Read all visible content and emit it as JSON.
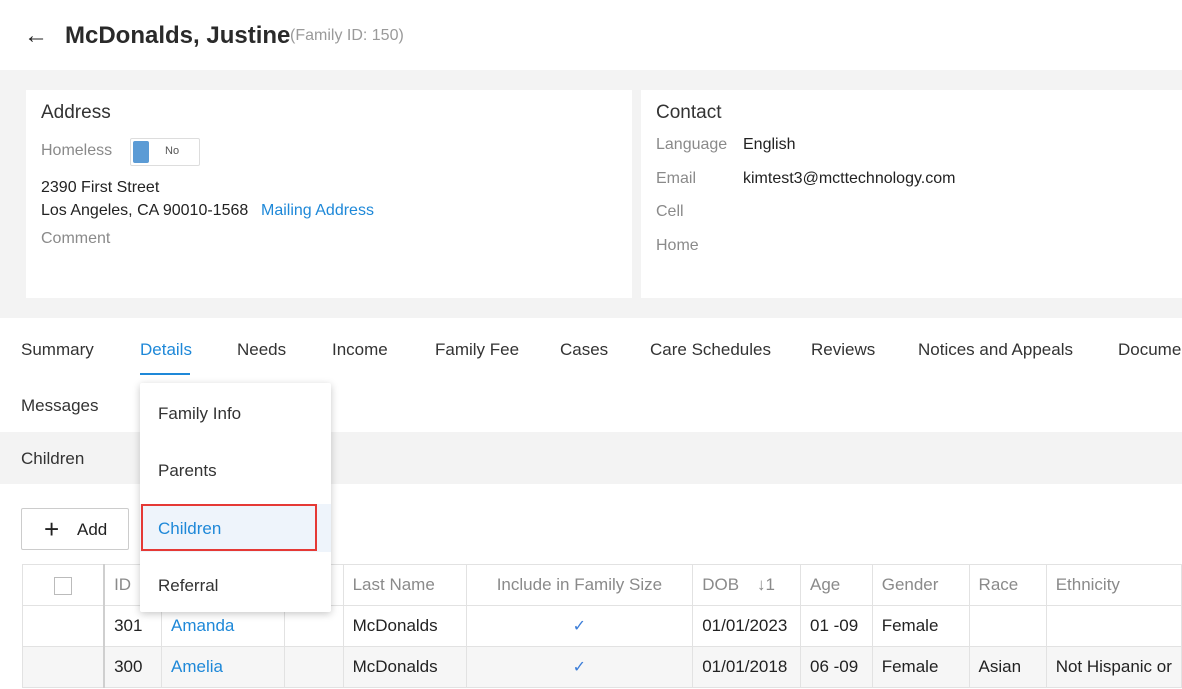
{
  "header": {
    "title": "McDonalds, Justine",
    "family_id": "(Family ID: 150)"
  },
  "address": {
    "heading": "Address",
    "homeless_label": "Homeless",
    "homeless_value": "No",
    "street": "2390 First Street",
    "city_line": "Los Angeles, CA 90010-1568",
    "mailing_link": "Mailing Address",
    "comment_label": "Comment"
  },
  "contact": {
    "heading": "Contact",
    "language_label": "Language",
    "language_value": "English",
    "email_label": "Email",
    "email_value": "kimtest3@mcttechnology.com",
    "cell_label": "Cell",
    "home_label": "Home"
  },
  "tabs": [
    "Summary",
    "Details",
    "Needs",
    "Income",
    "Family Fee",
    "Cases",
    "Care Schedules",
    "Reviews",
    "Notices and Appeals",
    "Documer",
    "Messages"
  ],
  "section_title": "Children",
  "add_label": "Add",
  "dropdown": [
    "Family Info",
    "Parents",
    "Children",
    "Referral"
  ],
  "table": {
    "headers": [
      "ID",
      "Last Name",
      "Include in Family Size",
      "DOB",
      "Age",
      "Gender",
      "Race",
      "Ethnicity"
    ],
    "sort_indicator": "↓1",
    "rows": [
      {
        "id": "301",
        "first": "Amanda",
        "last": "McDonalds",
        "include": "✓",
        "dob": "01/01/2023",
        "age": "01 -09",
        "gender": "Female",
        "race": "",
        "ethnicity": ""
      },
      {
        "id": "300",
        "first": "Amelia",
        "last": "McDonalds",
        "include": "✓",
        "dob": "01/01/2018",
        "age": "06 -09",
        "gender": "Female",
        "race": "Asian",
        "ethnicity": "Not Hispanic or"
      }
    ]
  },
  "colors": {
    "accent": "#1e88d8",
    "highlight": "#e53935",
    "toggle": "#5b9bd5"
  }
}
